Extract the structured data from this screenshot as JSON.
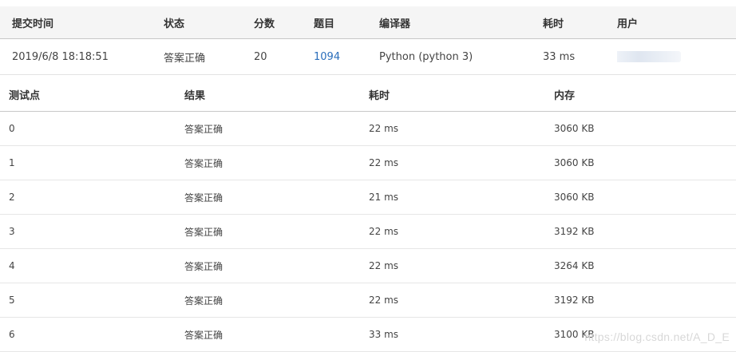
{
  "submission": {
    "headers": {
      "time": "提交时间",
      "status": "状态",
      "score": "分数",
      "problem": "题目",
      "compiler": "编译器",
      "duration": "耗时",
      "user": "用户"
    },
    "row": {
      "time": "2019/6/8 18:18:51",
      "status": "答案正确",
      "score": "20",
      "problem": "1094",
      "compiler": "Python (python 3)",
      "duration": "33 ms"
    }
  },
  "cases": {
    "headers": {
      "id": "测试点",
      "result": "结果",
      "duration": "耗时",
      "memory": "内存"
    },
    "rows": [
      {
        "id": "0",
        "result": "答案正确",
        "duration": "22 ms",
        "memory": "3060 KB"
      },
      {
        "id": "1",
        "result": "答案正确",
        "duration": "22 ms",
        "memory": "3060 KB"
      },
      {
        "id": "2",
        "result": "答案正确",
        "duration": "21 ms",
        "memory": "3060 KB"
      },
      {
        "id": "3",
        "result": "答案正确",
        "duration": "22 ms",
        "memory": "3192 KB"
      },
      {
        "id": "4",
        "result": "答案正确",
        "duration": "22 ms",
        "memory": "3264 KB"
      },
      {
        "id": "5",
        "result": "答案正确",
        "duration": "22 ms",
        "memory": "3192 KB"
      },
      {
        "id": "6",
        "result": "答案正确",
        "duration": "33 ms",
        "memory": "3100 KB"
      }
    ]
  },
  "watermark": "https://blog.csdn.net/A_D_E",
  "colors": {
    "accepted": "#e4393c",
    "link": "#2a6ebb",
    "header_bg": "#f5f5f5"
  }
}
